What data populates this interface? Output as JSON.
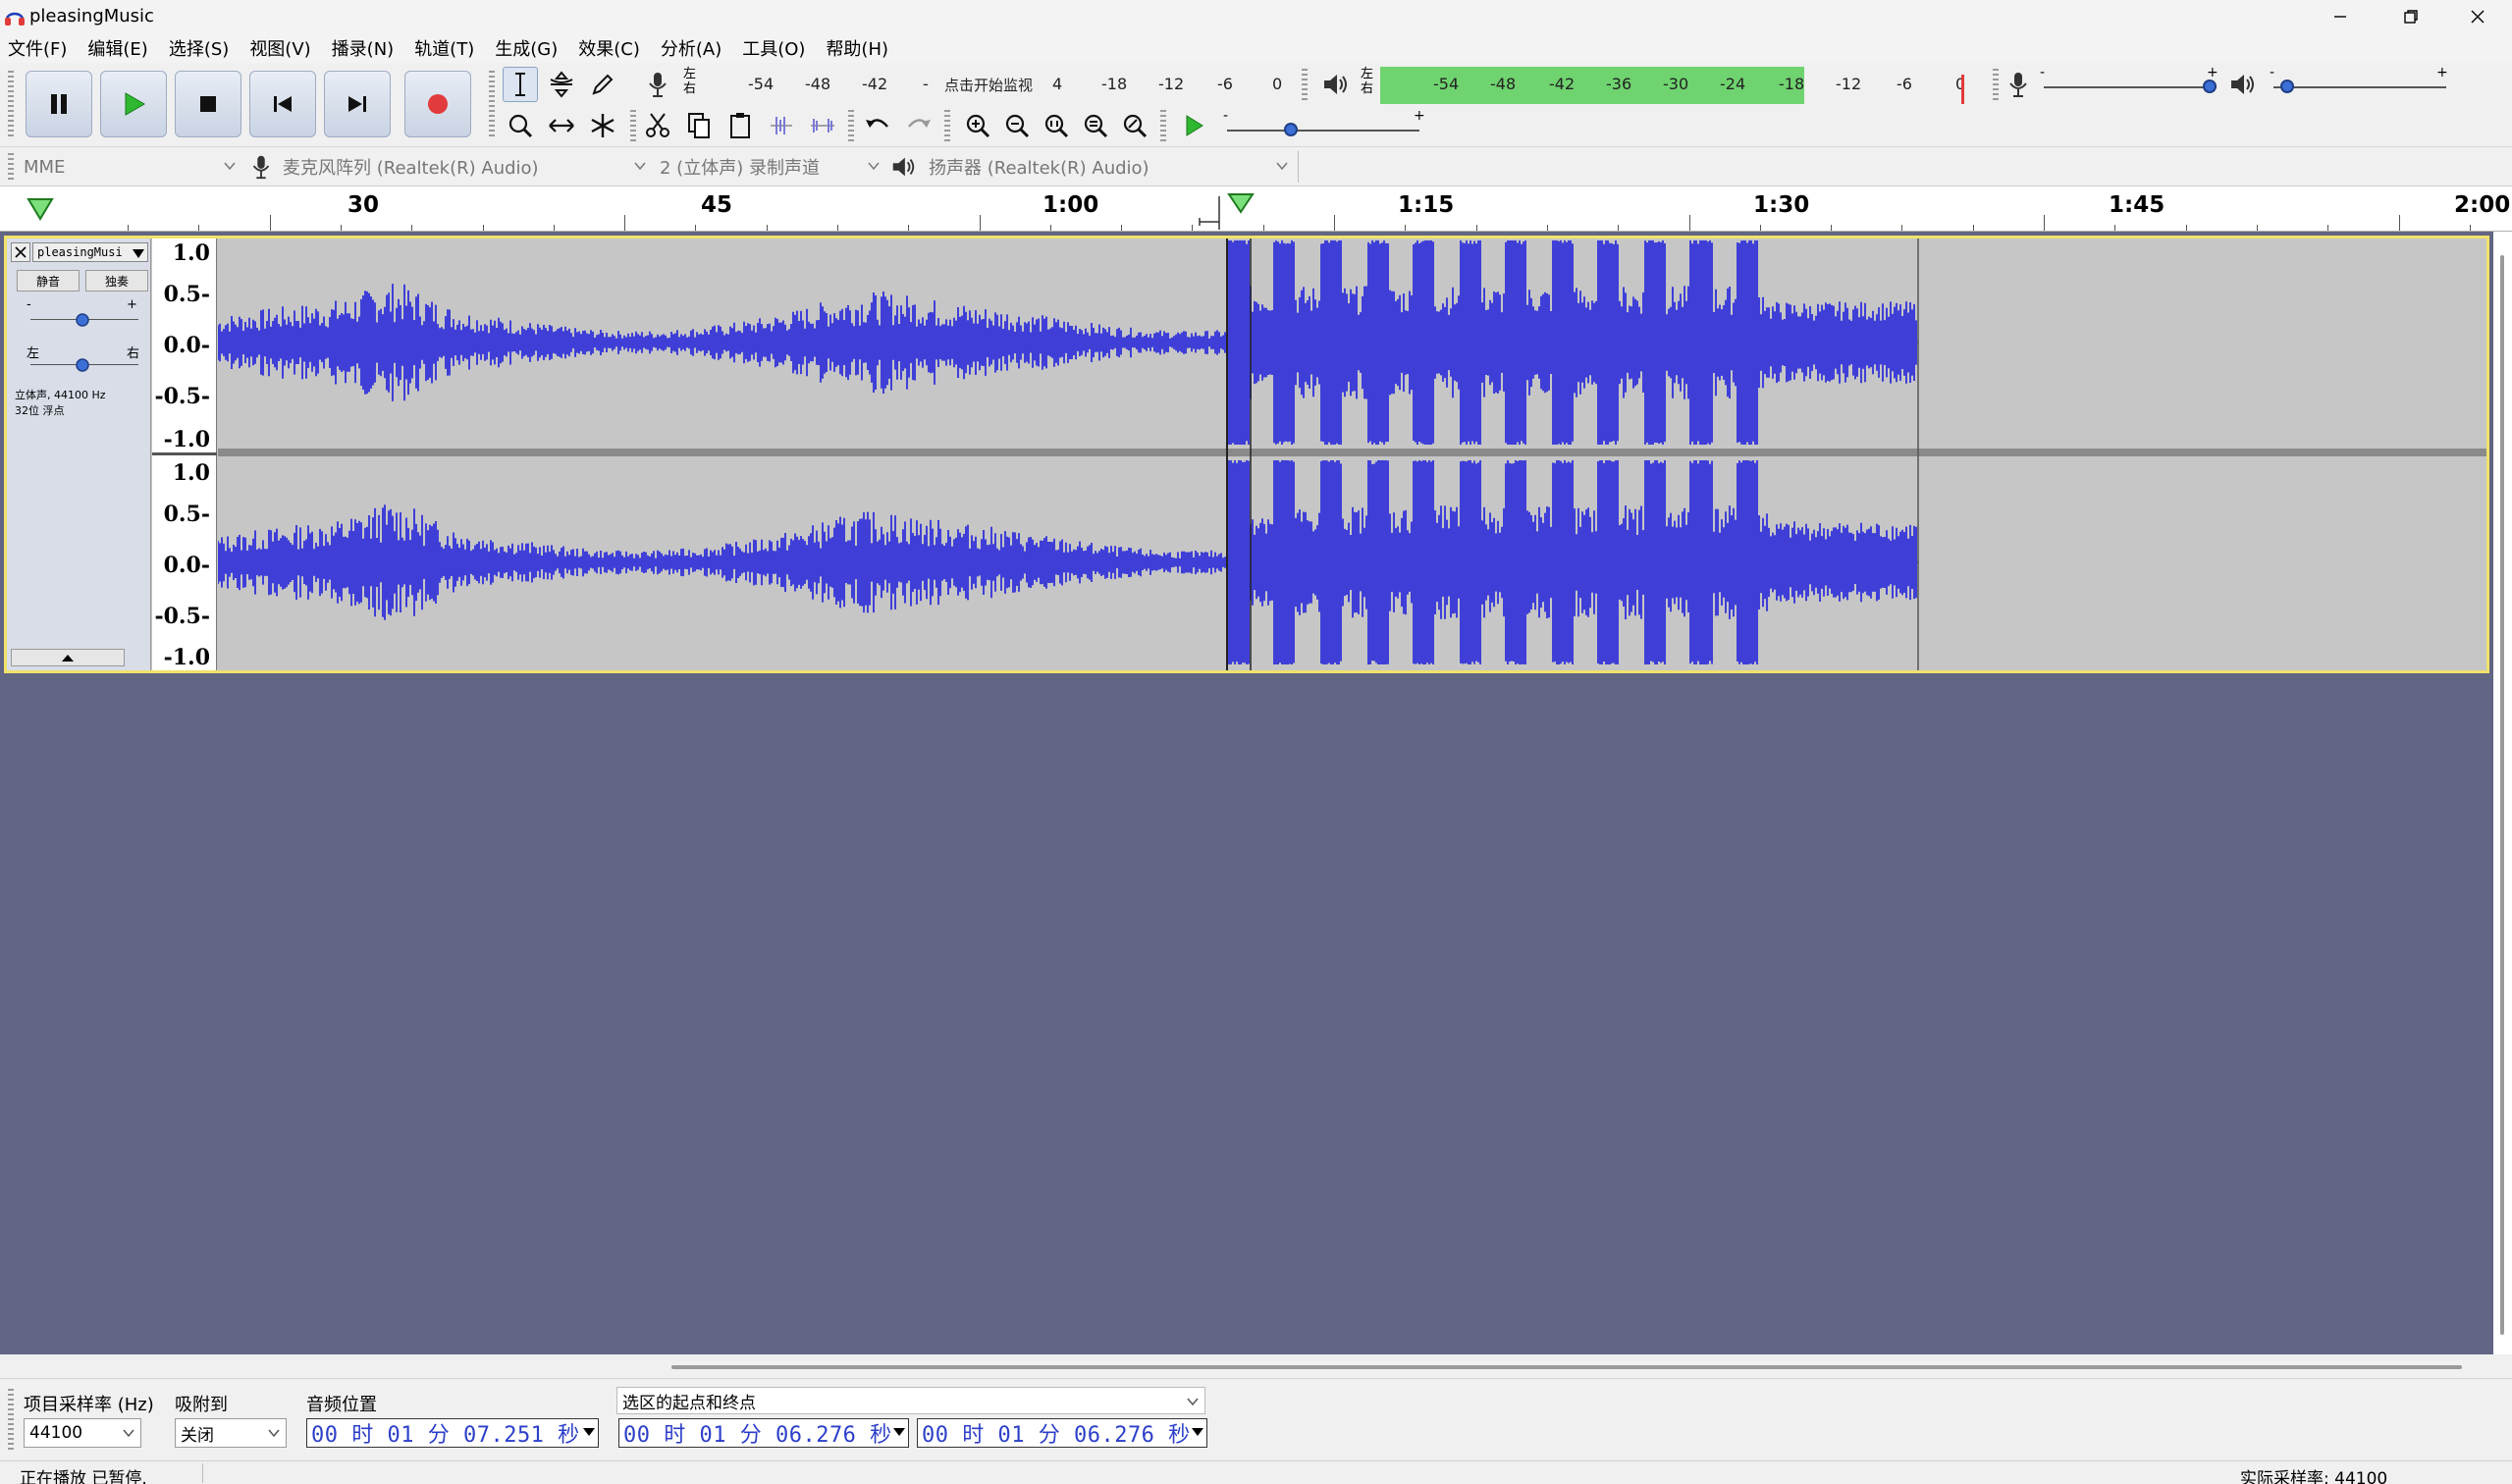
{
  "window": {
    "title": "pleasingMusic"
  },
  "menu": {
    "items": [
      "文件(F)",
      "编辑(E)",
      "选择(S)",
      "视图(V)",
      "播录(N)",
      "轨道(T)",
      "生成(G)",
      "效果(C)",
      "分析(A)",
      "工具(O)",
      "帮助(H)"
    ]
  },
  "meters": {
    "record": {
      "channels": "左\n右",
      "scale": [
        "-54",
        "-48",
        "-42",
        "-",
        "4",
        "-18",
        "-12",
        "-6",
        "0"
      ],
      "monitor_prompt": "点击开始监视"
    },
    "playback": {
      "channels": "左\n右",
      "scale": [
        "-54",
        "-48",
        "-42",
        "-36",
        "-30",
        "-24",
        "-18",
        "-12",
        "-6",
        "0"
      ],
      "level_fraction": 0.72
    },
    "record_volume": {
      "min": "-",
      "max": "+",
      "value": 0.96
    },
    "play_volume": {
      "min": "-",
      "max": "+",
      "value": 0.08
    },
    "speed": {
      "min": "-",
      "max": "+",
      "value": 0.33
    }
  },
  "devices": {
    "host": "MME",
    "input": "麦克风阵列 (Realtek(R) Audio)",
    "channels": "2 (立体声) 录制声道",
    "output": "扬声器 (Realtek(R) Audio)"
  },
  "ruler": {
    "labels": [
      "30",
      "45",
      "1:00",
      "1:15",
      "1:30",
      "1:45",
      "2:00"
    ]
  },
  "track": {
    "name": "pleasingMusi",
    "mute": "静音",
    "solo": "独奏",
    "gain_min": "-",
    "gain_max": "+",
    "pan_left": "左",
    "pan_right": "右",
    "info_line1": "立体声, 44100 Hz",
    "info_line2": "32位 浮点",
    "vruler": [
      "1.0",
      "0.5-",
      "0.0-",
      "-0.5-",
      "-1.0"
    ],
    "vruler2": [
      "1.0",
      "0.5-",
      "0.0-",
      "-0.5-",
      "-1.0"
    ]
  },
  "selection_toolbar": {
    "rate_label": "项目采样率 (Hz)",
    "rate_value": "44100",
    "snap_label": "吸附到",
    "snap_value": "关闭",
    "position_label": "音频位置",
    "position_value": "00 时 01 分 07.251 秒",
    "selection_label": "选区的起点和终点",
    "sel_start": "00 时 01 分 06.276 秒",
    "sel_end": "00 时 01 分 06.276 秒"
  },
  "status": {
    "left": "正在播放 已暂停.",
    "right": "实际采样率: 44100"
  },
  "colors": {
    "waveform": "#3f3fd8",
    "track_bg": "#c6c6c6",
    "area_bg": "#626584",
    "selection_border": "#f0e26a",
    "meter_green": "#6fd36f",
    "record_red": "#e23b3b",
    "play_green": "#2fb82f"
  }
}
